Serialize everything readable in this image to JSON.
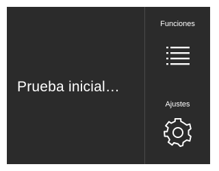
{
  "main": {
    "status_text": "Prueba inicial…"
  },
  "sidebar": {
    "functions": {
      "label": "Funciones",
      "icon": "list-icon"
    },
    "settings": {
      "label": "Ajustes",
      "icon": "gear-icon"
    }
  },
  "colors": {
    "background": "#2b2b2b",
    "text": "#ffffff",
    "divider": "#4a4a4a"
  }
}
